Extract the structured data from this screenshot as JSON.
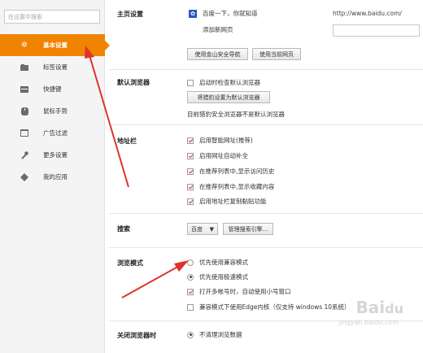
{
  "sidebar": {
    "search_placeholder": "在设置中搜索",
    "items": [
      {
        "label": "基本设置",
        "icon": "gear-icon"
      },
      {
        "label": "标签设置",
        "icon": "tab-icon"
      },
      {
        "label": "快捷键",
        "icon": "keyboard-icon"
      },
      {
        "label": "鼠标手势",
        "icon": "mouse-icon"
      },
      {
        "label": "广告过滤",
        "icon": "filter-icon"
      },
      {
        "label": "更多设置",
        "icon": "wrench-icon"
      },
      {
        "label": "我的应用",
        "icon": "apps-icon"
      }
    ]
  },
  "homepage": {
    "title": "主页设置",
    "site_name": "百度一下，你就知道",
    "site_url": "http://www.baidu.com/",
    "add_new": "添加新网页",
    "btn_safe_nav": "使用金山安全导航",
    "btn_current": "使用当前网页"
  },
  "default_browser": {
    "title": "默认浏览器",
    "check_on_start": "启动时检查默认浏览器",
    "btn_set_default": "将猎豹设置为默认浏览器",
    "status": "目前猎豹安全浏览器不是默认浏览器"
  },
  "address_bar": {
    "title": "地址栏",
    "options": [
      {
        "label": "启用智能网址(推荐)",
        "checked": true
      },
      {
        "label": "启用网址自动补全",
        "checked": true
      },
      {
        "label": "在推荐列表中,显示访问历史",
        "checked": true
      },
      {
        "label": "在推荐列表中,显示收藏内容",
        "checked": true
      },
      {
        "label": "启用地址栏复制黏贴功能",
        "checked": true
      }
    ]
  },
  "search": {
    "title": "搜索",
    "engine": "百度",
    "btn_manage": "管理搜索引擎..."
  },
  "browse_mode": {
    "title": "浏览模式",
    "options": [
      {
        "label": "优先使用兼容模式",
        "selected": false
      },
      {
        "label": "优先使用极速模式",
        "selected": true
      }
    ],
    "open_multi": {
      "label": "打开多帐号时，自动使用小号窗口",
      "checked": true
    },
    "edge_kernel": {
      "label": "兼容模式下使用Edge内核（仅支持 windows 10系统）",
      "checked": false
    }
  },
  "close_browser": {
    "title": "关闭浏览器时",
    "option": "不清理浏览数据"
  },
  "colors": {
    "accent": "#f08300",
    "arrow": "#e0322b"
  }
}
